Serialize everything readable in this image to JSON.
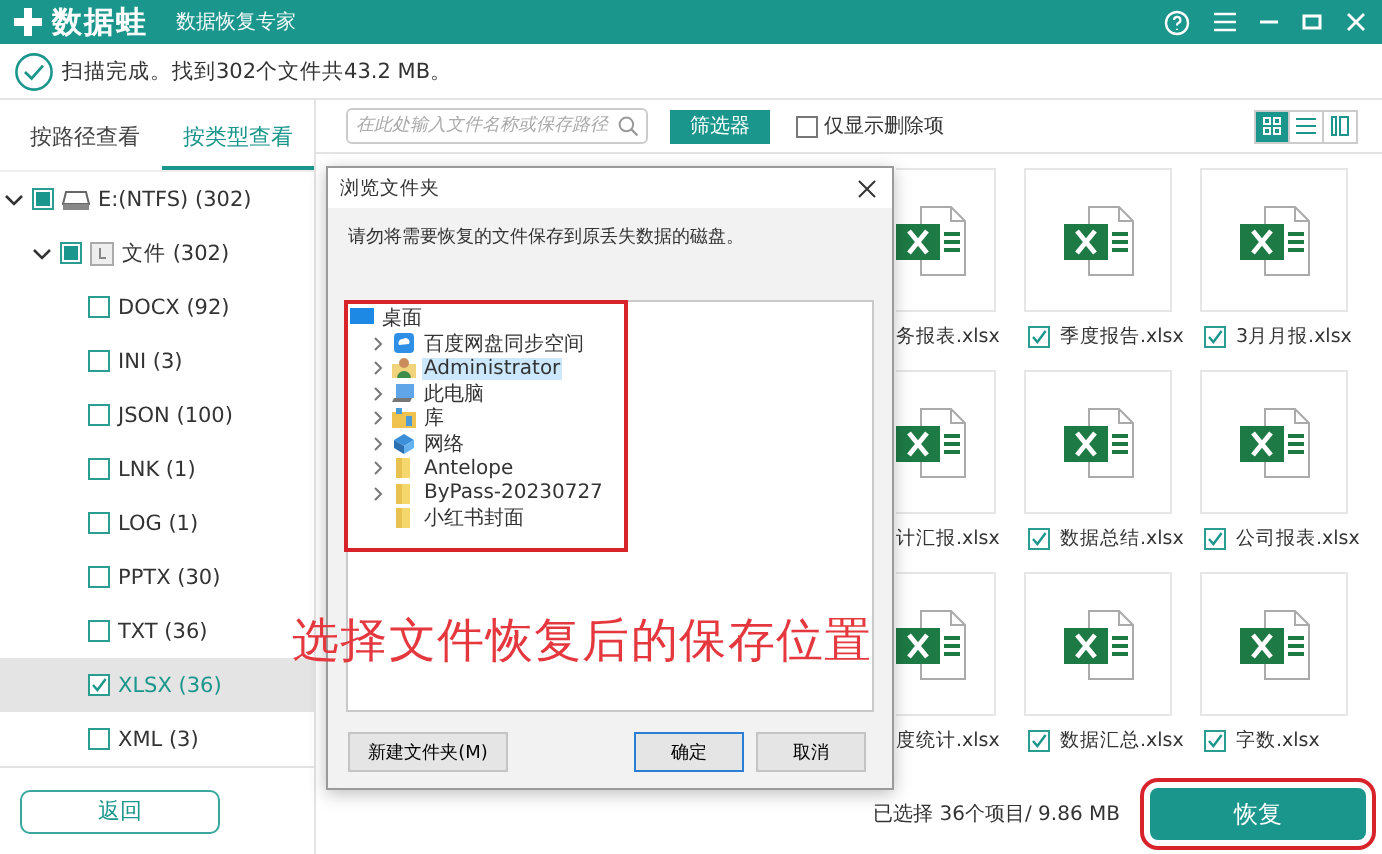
{
  "window": {
    "app_name": "数据蛙",
    "subtitle": "数据恢复专家"
  },
  "scan_status": "扫描完成。找到302个文件共43.2 MB。",
  "view_tabs": [
    {
      "label": "按路径查看",
      "selected": false
    },
    {
      "label": "按类型查看",
      "selected": true
    }
  ],
  "tree": [
    {
      "label": "E:(NTFS) (302)",
      "kind": "drive",
      "checked": false,
      "partial": true,
      "expanded": true,
      "selected": false,
      "children": [
        {
          "label": "文件 (302)",
          "kind": "folder",
          "checked": false,
          "partial": true,
          "expanded": true,
          "selected": false,
          "children": [
            {
              "label": "DOCX (92)",
              "checked": false,
              "selected": false
            },
            {
              "label": "INI (3)",
              "checked": false,
              "selected": false
            },
            {
              "label": "JSON (100)",
              "checked": false,
              "selected": false
            },
            {
              "label": "LNK (1)",
              "checked": false,
              "selected": false
            },
            {
              "label": "LOG (1)",
              "checked": false,
              "selected": false
            },
            {
              "label": "PPTX (30)",
              "checked": false,
              "selected": false
            },
            {
              "label": "TXT (36)",
              "checked": false,
              "selected": false
            },
            {
              "label": "XLSX (36)",
              "checked": true,
              "selected": true
            },
            {
              "label": "XML (3)",
              "checked": false,
              "selected": false
            }
          ]
        }
      ]
    }
  ],
  "back_button": "返回",
  "search": {
    "placeholder": "在此处输入文件名称或保存路径"
  },
  "filter_button": "筛选器",
  "deleted_only": {
    "label": "仅显示删除项",
    "checked": false
  },
  "view_modes": [
    {
      "kind": "grid",
      "selected": true
    },
    {
      "kind": "list",
      "selected": false
    },
    {
      "kind": "detail",
      "selected": false
    }
  ],
  "files": [
    {
      "name": "务报表.xlsx"
    },
    {
      "name": "季度报告.xlsx",
      "checked": true
    },
    {
      "name": "3月月报.xlsx",
      "checked": true
    },
    {
      "name": "计汇报.xlsx"
    },
    {
      "name": "数据总结.xlsx",
      "checked": true
    },
    {
      "name": "公司报表.xlsx",
      "checked": true
    },
    {
      "name": "度统计.xlsx"
    },
    {
      "name": "数据汇总.xlsx",
      "checked": true
    },
    {
      "name": "字数.xlsx",
      "checked": true
    }
  ],
  "selection_summary": "已选择 36个项目/ 9.86 MB",
  "recover_button": "恢复",
  "dialog": {
    "title": "浏览文件夹",
    "message": "请勿将需要恢复的文件保存到原丢失数据的磁盘。",
    "folders": [
      {
        "label": "桌面",
        "kind": "desktop",
        "expanded": true,
        "selected": false,
        "children": [
          {
            "label": "百度网盘同步空间",
            "kind": "cloud",
            "expandable": true,
            "selected": false
          },
          {
            "label": "Administrator",
            "kind": "user",
            "expandable": true,
            "selected": true
          },
          {
            "label": "此电脑",
            "kind": "computer",
            "expandable": true,
            "selected": false
          },
          {
            "label": "库",
            "kind": "library",
            "expandable": true,
            "selected": false
          },
          {
            "label": "网络",
            "kind": "network",
            "expandable": true,
            "selected": false
          },
          {
            "label": "Antelope",
            "kind": "folder",
            "expandable": true,
            "selected": false
          },
          {
            "label": "ByPass-20230727",
            "kind": "folder",
            "expandable": true,
            "selected": false
          },
          {
            "label": "小红书封面",
            "kind": "folder",
            "expandable": false,
            "selected": false
          }
        ]
      }
    ],
    "buttons": [
      {
        "label": "新建文件夹(M)",
        "kind": "secondary",
        "focused": false
      },
      {
        "label": "确定",
        "kind": "primary",
        "focused": true
      },
      {
        "label": "取消",
        "kind": "primary",
        "focused": false
      }
    ]
  },
  "annotation": "选择文件恢复后的保存位置"
}
